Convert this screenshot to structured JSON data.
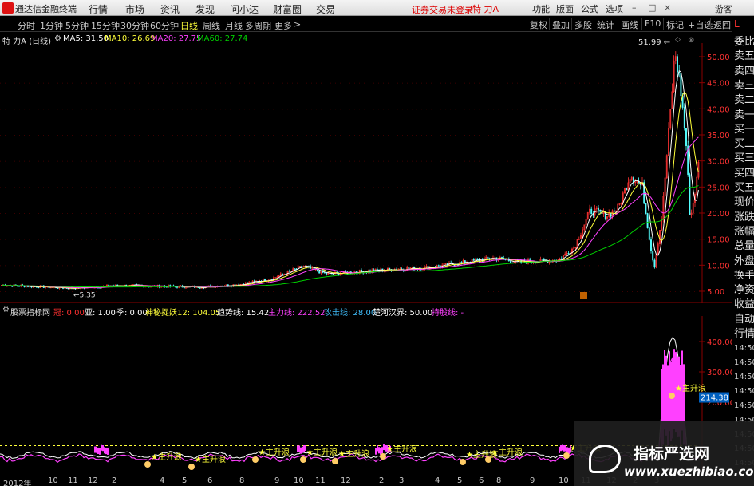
{
  "app": {
    "title": "通达信金融终端",
    "menu": [
      "行情",
      "市场",
      "资讯",
      "发现",
      "问小达",
      "财富圈",
      "交易"
    ],
    "status": "证券交易未登录",
    "stock": "特 力A",
    "right_menu": [
      "功能",
      "版面",
      "公式",
      "选项"
    ],
    "guest": "游客"
  },
  "periods": [
    "分时",
    "1分钟",
    "5分钟",
    "15分钟",
    "30分钟",
    "60分钟",
    "日线",
    "周线",
    "月线",
    "多周期",
    "更多"
  ],
  "active_period": "日线",
  "tools": [
    "复权",
    "叠加",
    "多股",
    "统计",
    "画线",
    "F10",
    "标记",
    "+自选",
    "返回"
  ],
  "price_panel": {
    "stock_label": "特 力A (日线)",
    "ma5": "MA5: 31.50",
    "ma10": "MA10: 26.69",
    "ma20": "MA20: 27.75",
    "ma60": "MA60: 27.74",
    "peak_label": "51.99",
    "low_label": "5.35",
    "y_ticks": [
      "50.00",
      "45.00",
      "40.00",
      "35.00",
      "30.00",
      "25.00",
      "20.00",
      "15.00",
      "10.00",
      "5.00"
    ]
  },
  "indicator_panel": {
    "name": "股票指标网",
    "fields": [
      "冠: 0.00",
      "亚: 1.00",
      "季: 0.00",
      "神秘捉妖12: 104.05",
      "趋势线: 15.42",
      "主力线: 222.52",
      "攻击线: 28.00",
      "楚河汉界: 50.00",
      "持股线: -"
    ],
    "field_colors": [
      "#ff3030",
      "#ffffff",
      "#ffffff",
      "#ffff3a",
      "#ffffff",
      "#ff40ff",
      "#40c0ff",
      "#ffffff",
      "#ff40ff"
    ],
    "y_ticks": [
      "400.00",
      "300.00",
      "200.00"
    ],
    "current_value": "214.38",
    "signal_label": "主升浪"
  },
  "date_axis": [
    "2012年",
    "10",
    "11",
    "12",
    "2",
    "4",
    "5",
    "6",
    "8",
    "9",
    "10",
    "11",
    "12",
    "2",
    "3",
    "4",
    "5",
    "6",
    "8",
    "9",
    "10",
    "11",
    "12",
    "2",
    "3"
  ],
  "right_panel": {
    "header": "L",
    "items": [
      "委比",
      "卖五",
      "卖四",
      "卖三",
      "卖二",
      "卖一",
      "买一",
      "买二",
      "买三",
      "买四",
      "买五",
      "现价",
      "涨跌",
      "涨幅",
      "总量",
      "外盘",
      "换手",
      "净资",
      "收益",
      "自动",
      "行情"
    ],
    "times": [
      "14:50",
      "14:50",
      "14:50",
      "14:50",
      "14:50",
      "14:50",
      "14:50",
      "14:50",
      "14:50"
    ]
  },
  "watermark": {
    "cn": "指标严选网",
    "url": "www.xuezhibiao.com"
  },
  "colors": {
    "up": "#ff3232",
    "down": "#54ffff",
    "ma5": "#ffffff",
    "ma10": "#ffff3a",
    "ma20": "#ff40ff",
    "ma60": "#00d000"
  }
}
